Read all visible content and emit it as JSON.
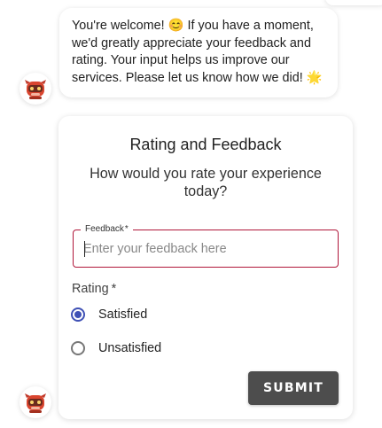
{
  "message": {
    "text": "You're welcome! 😊 If you have a moment, we'd greatly appreciate your feedback and rating. Your input helps us improve our services. Please let us know how we did! 🌟"
  },
  "feedback_card": {
    "title": "Rating and Feedback",
    "question": "How would you rate your experience today?",
    "feedback_field": {
      "label": "Feedback",
      "required_mark": "*",
      "value": "",
      "placeholder": "Enter your feedback here"
    },
    "rating": {
      "label": "Rating",
      "required_mark": "*",
      "options": [
        {
          "label": "Satisfied",
          "selected": true
        },
        {
          "label": "Unsatisfied",
          "selected": false
        }
      ]
    },
    "submit_label": "SUBMIT"
  },
  "avatars": {
    "icon": "robot-mascot-icon"
  },
  "colors": {
    "field_border": "#b0173a",
    "radio_accent": "#3f51b5",
    "submit_background": "#4d4d4d"
  }
}
